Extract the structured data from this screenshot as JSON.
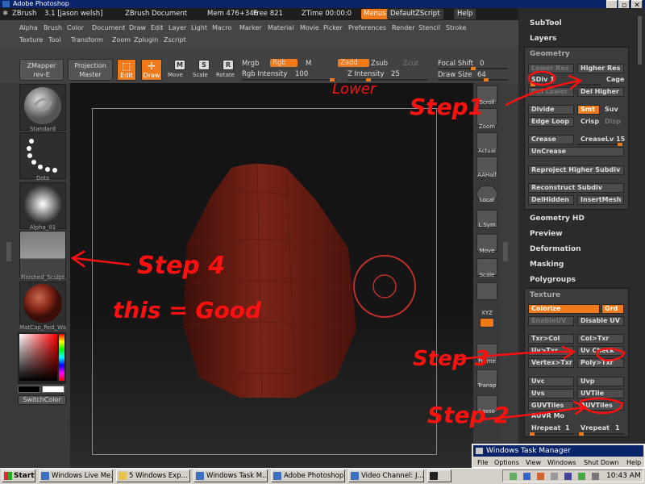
{
  "photoshop": {
    "title": "Adobe Photoshop"
  },
  "zbrush": {
    "app_name": "ZBrush",
    "version_user": "3.1 [jason welsh]",
    "document": "ZBrush Document",
    "mem": "Mem 476+346",
    "free": "Free 821",
    "ztime": "ZTime 00:00:0",
    "menus": "Menus",
    "default_zscript": "DefaultZScript",
    "help": "Help"
  },
  "menubar": {
    "row1": [
      "Alpha",
      "Brush",
      "Color",
      "Document",
      "Draw",
      "Edit",
      "Layer",
      "Light",
      "Macro",
      "Marker",
      "Material",
      "Movie",
      "Picker",
      "Preferences",
      "Render",
      "Stencil",
      "Stroke"
    ],
    "row2": [
      "Texture",
      "Tool",
      "Transform",
      "Zoom",
      "Zplugin",
      "Zscript"
    ]
  },
  "toolbar": {
    "zmapper": "ZMapper",
    "zmapper_rev": "rev-E",
    "projection": "Projection",
    "master": "Master",
    "edit": "Edit",
    "draw": "Draw",
    "move": "Move",
    "scale": "Scale",
    "rotate": "Rotate",
    "m_glyph": "M",
    "s_glyph": "S",
    "r_glyph": "R",
    "mrgb": "Mrgb",
    "rgb": "Rgb",
    "m": "M",
    "zadd": "Zadd",
    "zsub": "Zsub",
    "zcut": "Zcut",
    "rgb_intensity": "Rgb Intensity",
    "rgb_intensity_val": "100",
    "z_intensity": "Z Intensity",
    "z_intensity_val": "25",
    "focal_shift": "Focal Shift",
    "focal_shift_val": "0",
    "draw_size": "Draw Size",
    "draw_size_val": "64"
  },
  "left_shelf": {
    "items": [
      {
        "label": "Standard"
      },
      {
        "label": "Dots"
      },
      {
        "label": "Alpha_01"
      },
      {
        "label": "Finished_Sculpt"
      },
      {
        "label": "MatCap_Red_Wa"
      }
    ],
    "switchcolor": "SwitchColor"
  },
  "right_shelf": {
    "items": [
      "Scroll",
      "Zoom",
      "Actual",
      "AAHalf",
      "Local",
      "L.Sym",
      "Move",
      "Scale",
      "XYZ",
      "Frame",
      "Transp",
      "Lasso"
    ]
  },
  "palette": {
    "subtool": "SubTool",
    "layers": "Layers",
    "geometry": "Geometry",
    "lower_res": "Lower Res",
    "higher_res": "Higher Res",
    "sdiv": "SDiv 1",
    "cage": "Cage",
    "del_lower": "Del Lower",
    "del_higher": "Del Higher",
    "divide": "Divide",
    "smt": "Smt",
    "suv": "Suv",
    "edge_loop": "Edge Loop",
    "crisp": "Crisp",
    "disp": "Disp",
    "crease": "Crease",
    "crease_lvl": "CreaseLvl",
    "crease_lvl_val": "15",
    "uncrease": "UnCrease",
    "reproject": "Reproject Higher Subdiv",
    "reconstruct": "Reconstruct Subdiv",
    "delhidden": "DelHidden",
    "insertmesh": "InsertMesh",
    "geometry_hd": "Geometry HD",
    "preview": "Preview",
    "deformation": "Deformation",
    "masking": "Masking",
    "polygroups": "Polygroups",
    "texture": "Texture",
    "colorize": "Colorize",
    "grd": "Grd",
    "enableuv": "EnableUV",
    "disable_uv": "Disable UV",
    "txr_col": "Txr>Col",
    "col_txr": "Col>Txr",
    "uv_txr": "Uv>Txr",
    "uv_check": "Uv Check",
    "vertex_txr": "Vertex>Txr",
    "poly_txr": "Poly>Txr",
    "uvc": "Uvc",
    "uvp": "Uvp",
    "uvs": "Uvs",
    "uvtile": "UVTile",
    "guvtiles": "GUVTiles",
    "auvtiles": "AUVTiles",
    "auvr_mo": "AUVR Mo",
    "hrepeat": "Hrepeat",
    "hrepeat_val": "1",
    "vrepeat": "Vrepeat",
    "vrepeat_val": "1"
  },
  "annotations": {
    "lower": "Lower",
    "step1": "Step1",
    "step2": "Step 2",
    "step3": "Step 3",
    "step4": "Step 4",
    "good": "this = Good"
  },
  "task_manager": {
    "title": "Windows Task Manager",
    "menu": [
      "File",
      "Options",
      "View",
      "Windows",
      "Shut Down",
      "Help"
    ]
  },
  "taskbar": {
    "start": "Start",
    "tasks": [
      "Windows Live Me...",
      "5 Windows Exp...",
      "Windows Task M...",
      "Adobe Photoshop",
      "Video Channel: J..."
    ],
    "clock": "10:43 AM"
  },
  "colors": {
    "accent": "#f07a1a",
    "annotation": "#ff1010",
    "model": "#6e1d14"
  }
}
